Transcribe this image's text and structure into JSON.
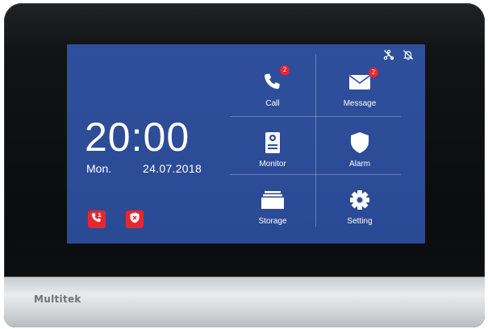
{
  "clock": {
    "time": "20:00",
    "day": "Mon.",
    "date": "24.07.2018"
  },
  "brand": {
    "name": "Multitek"
  },
  "menu": [
    {
      "label": "Call",
      "icon": "phone-icon",
      "badge": "2"
    },
    {
      "label": "Message",
      "icon": "envelope-icon",
      "badge": "2"
    },
    {
      "label": "Monitor",
      "icon": "door-station-icon"
    },
    {
      "label": "Alarm",
      "icon": "shield-icon"
    },
    {
      "label": "Storage",
      "icon": "folder-stack-icon"
    },
    {
      "label": "Setting",
      "icon": "gear-icon"
    }
  ],
  "quick_buttons": [
    {
      "icon": "call-guard-icon",
      "color": "#e8262e"
    },
    {
      "icon": "disarm-shield-icon",
      "color": "#e8262e"
    }
  ],
  "status_icons": [
    "network-off-icon",
    "bell-muted-icon"
  ],
  "colors": {
    "screen": "#2e4f9c",
    "accent": "#e8262e",
    "text": "#ffffff"
  }
}
